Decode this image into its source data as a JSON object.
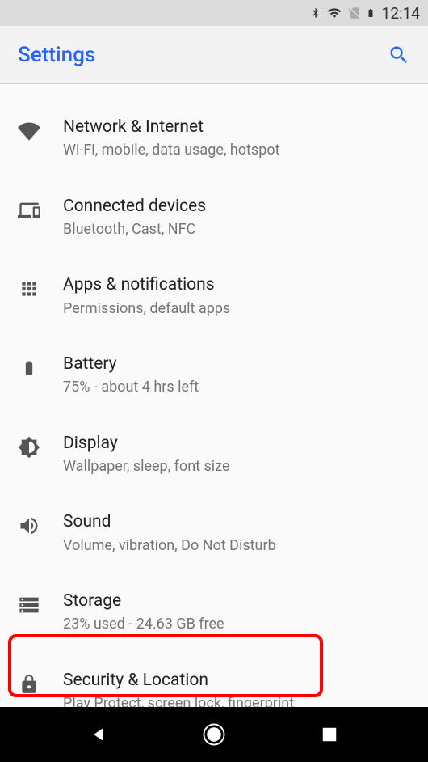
{
  "status": {
    "time": "12:14"
  },
  "appbar": {
    "title": "Settings"
  },
  "items": [
    {
      "title": "Network & Internet",
      "sub": "Wi-Fi, mobile, data usage, hotspot"
    },
    {
      "title": "Connected devices",
      "sub": "Bluetooth, Cast, NFC"
    },
    {
      "title": "Apps & notifications",
      "sub": "Permissions, default apps"
    },
    {
      "title": "Battery",
      "sub": "75% - about 4 hrs left"
    },
    {
      "title": "Display",
      "sub": "Wallpaper, sleep, font size"
    },
    {
      "title": "Sound",
      "sub": "Volume, vibration, Do Not Disturb"
    },
    {
      "title": "Storage",
      "sub": "23% used - 24.63 GB free"
    },
    {
      "title": "Security & Location",
      "sub": "Play Protect, screen lock, fingerprint"
    }
  ]
}
